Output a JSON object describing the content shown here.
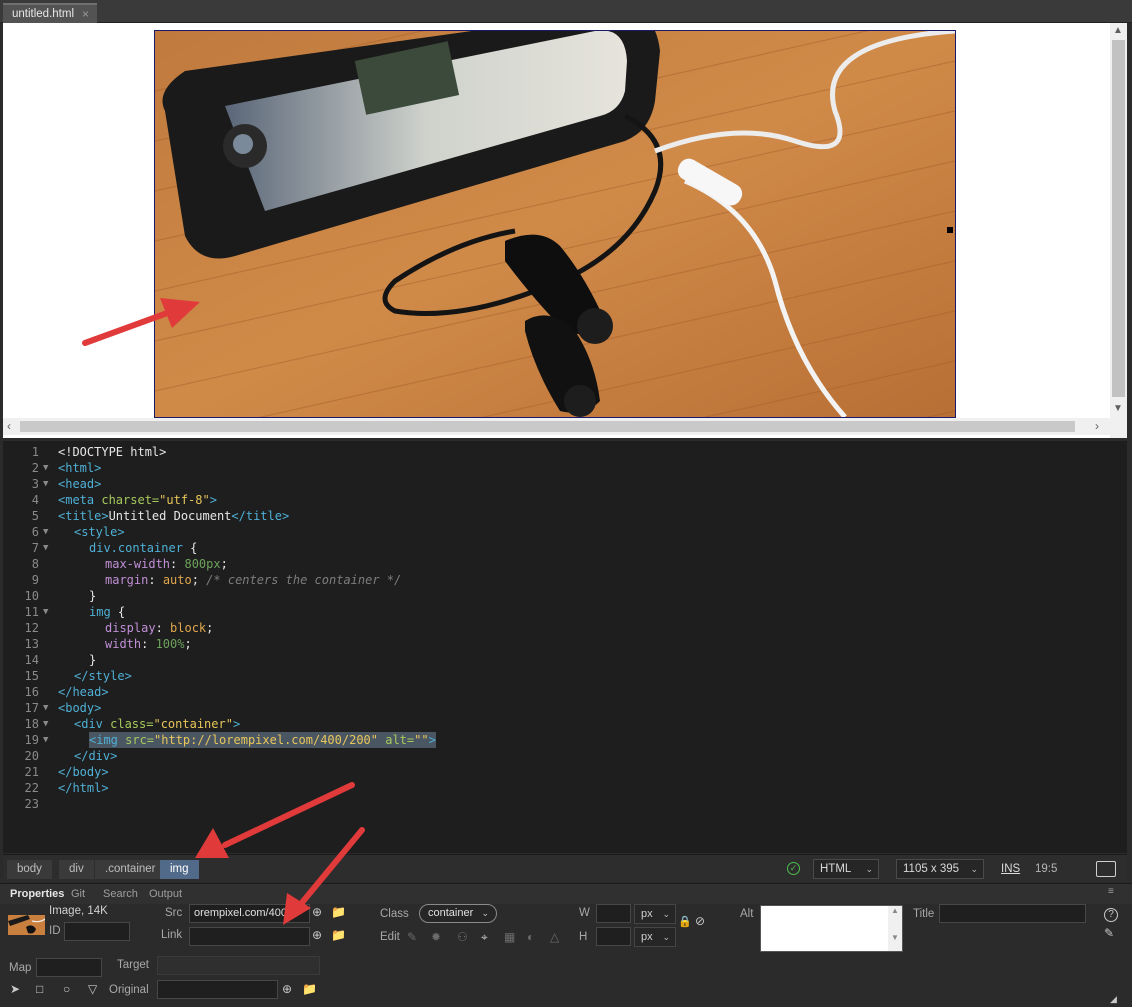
{
  "tab": {
    "title": "untitled.html",
    "close": "×"
  },
  "code": {
    "lines": [
      {
        "n": "1"
      },
      {
        "n": "2"
      },
      {
        "n": "3"
      },
      {
        "n": "4"
      },
      {
        "n": "5"
      },
      {
        "n": "6"
      },
      {
        "n": "7"
      },
      {
        "n": "8"
      },
      {
        "n": "9"
      },
      {
        "n": "10"
      },
      {
        "n": "11"
      },
      {
        "n": "12"
      },
      {
        "n": "13"
      },
      {
        "n": "14"
      },
      {
        "n": "15"
      },
      {
        "n": "16"
      },
      {
        "n": "17"
      },
      {
        "n": "18"
      },
      {
        "n": "19"
      },
      {
        "n": "20"
      },
      {
        "n": "21"
      },
      {
        "n": "22"
      },
      {
        "n": "23"
      }
    ],
    "text": {
      "l1": "<!DOCTYPE html>",
      "l2": "<html>",
      "l3": "<head>",
      "l4_tag": "<meta",
      "l4_attr": " charset=",
      "l4_val": "\"utf-8\"",
      "l4_end": ">",
      "l5_open": "<title>",
      "l5_text": "Untitled Document",
      "l5_close": "</title>",
      "l6": "<style>",
      "l7_sel": "div.container",
      "l7_brace": " {",
      "l8_prop": "max-width",
      "l8_colon": ": ",
      "l8_val": "800px",
      "l8_semi": ";",
      "l9_prop": "margin",
      "l9_colon": ": ",
      "l9_val": "auto",
      "l9_semi": "; ",
      "l9_comment": "/* centers the container */",
      "l10": "}",
      "l11_sel": "img",
      "l11_brace": " {",
      "l12_prop": "display",
      "l12_colon": ": ",
      "l12_val": "block",
      "l12_semi": ";",
      "l13_prop": "width",
      "l13_colon": ": ",
      "l13_val": "100%",
      "l13_semi": ";",
      "l14": "}",
      "l15": "</style>",
      "l16": "</head>",
      "l17": "<body>",
      "l18_tag": "<div",
      "l18_attr": " class=",
      "l18_val": "\"container\"",
      "l18_end": ">",
      "l19_tag": "<img",
      "l19_attr1": " src=",
      "l19_val1": "\"http://lorempixel.com/400/200\"",
      "l19_attr2": " alt=",
      "l19_val2": "\"\"",
      "l19_end": ">",
      "l20": "</div>",
      "l21": "</body>",
      "l22": "</html>"
    }
  },
  "statusbar": {
    "breadcrumbs": [
      "body",
      "div",
      ".container",
      "img"
    ],
    "doc_type": "HTML",
    "window_size": "1105 x 395",
    "mode": "INS",
    "cursor": "19:5"
  },
  "properties": {
    "tabs": [
      "Properties",
      "Git",
      "Search",
      "Output"
    ],
    "image_info": "Image, 14K",
    "id_label": "ID",
    "id_value": "",
    "src_label": "Src",
    "src_value": "orempixel.com/400",
    "link_label": "Link",
    "link_value": "",
    "class_label": "Class",
    "class_value": "container",
    "edit_label": "Edit",
    "w_label": "W",
    "h_label": "H",
    "w_unit": "px",
    "h_unit": "px",
    "alt_label": "Alt",
    "title_label": "Title",
    "map_label": "Map",
    "target_label": "Target",
    "original_label": "Original"
  },
  "colors": {
    "accent_selected_crumb": "#526a8a",
    "annotation_arrow": "#e03a3a",
    "status_ok": "#4cbf4c"
  },
  "icons": [
    "close-icon",
    "check-circle-icon",
    "live-preview-icon",
    "panel-menu-icon",
    "target-icon",
    "folder-icon",
    "lock-icon",
    "reset-size-icon",
    "help-icon",
    "edit-icon",
    "pointer-icon",
    "rect-hotspot-icon",
    "circle-hotspot-icon",
    "polygon-hotspot-icon"
  ]
}
